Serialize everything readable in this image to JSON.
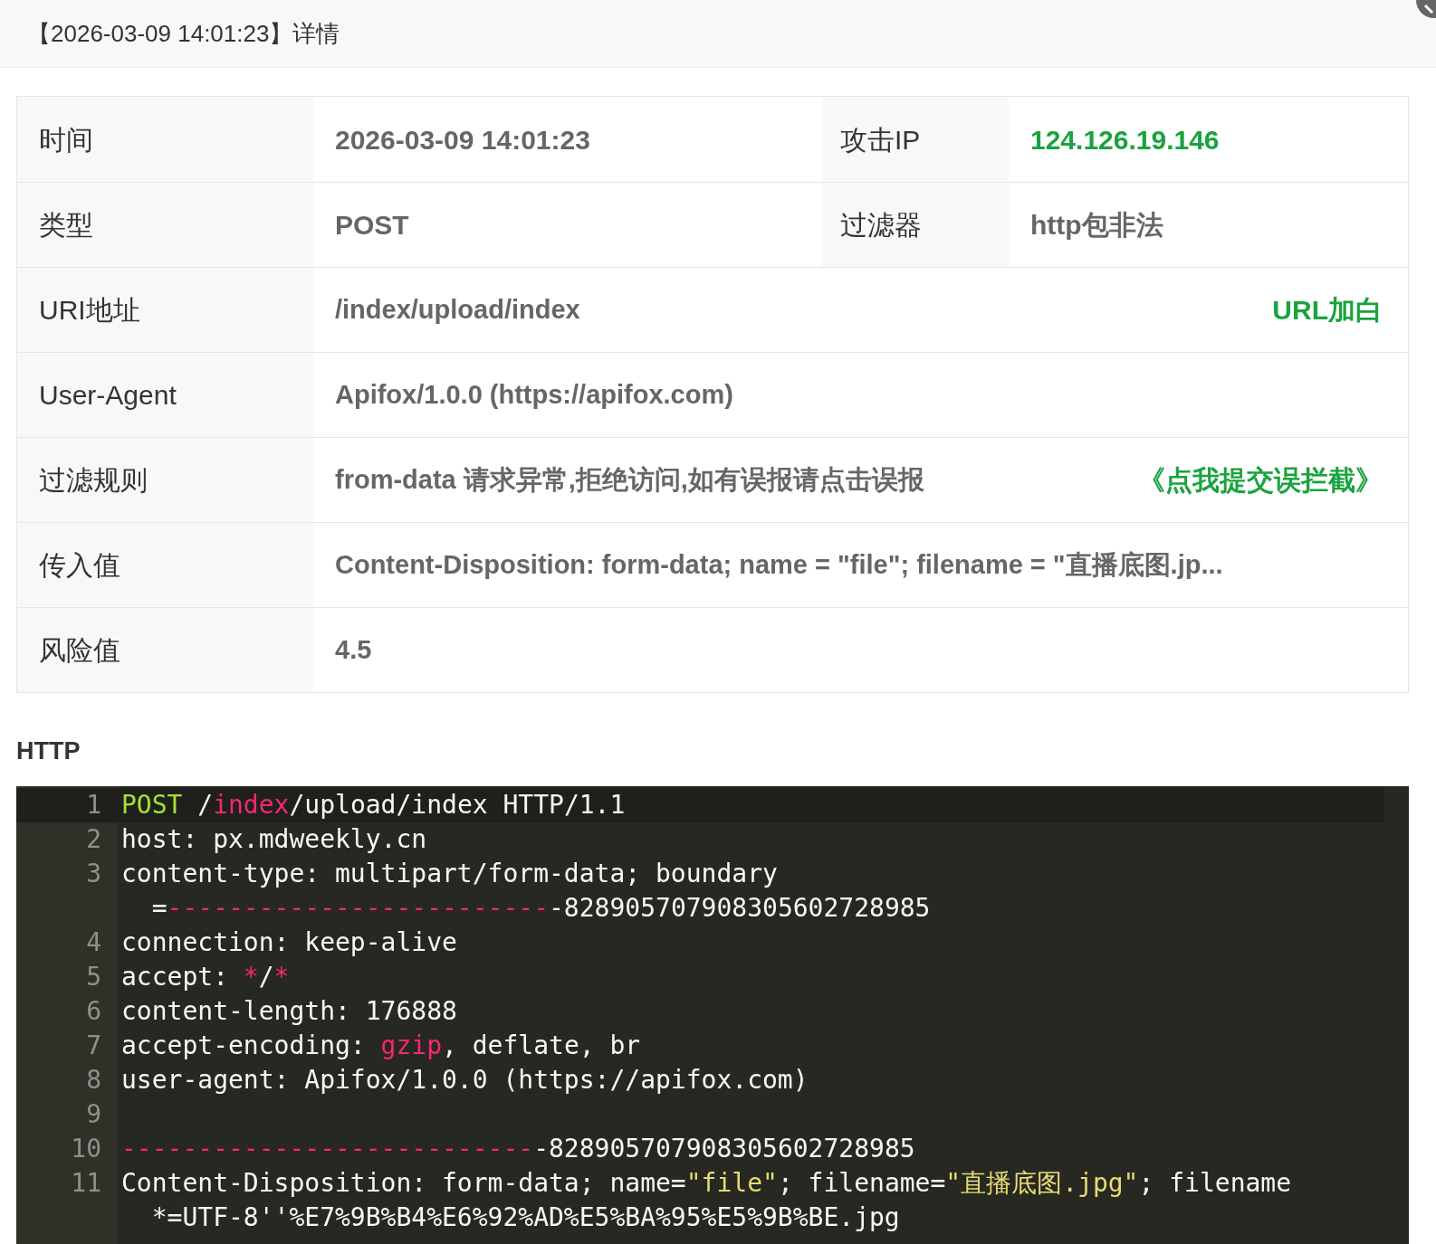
{
  "dialog": {
    "title": "【2026-03-09 14:01:23】详情"
  },
  "details": [
    {
      "kind": "pair",
      "label": "时间",
      "value": "2026-03-09 14:01:23",
      "label_2": "攻击IP",
      "value_2": "124.126.19.146",
      "value_2_highlighted": true
    },
    {
      "kind": "pair",
      "label": "类型",
      "value": "POST",
      "label_2": "过滤器",
      "value_2": "http包非法",
      "value_2_highlighted": false
    },
    {
      "kind": "single",
      "label": "URI地址",
      "value": "/index/upload/index",
      "action": "URL加白"
    },
    {
      "kind": "single",
      "label": "User-Agent",
      "value": "Apifox/1.0.0 (https://apifox.com)"
    },
    {
      "kind": "single",
      "label": "过滤规则",
      "value": "from-data 请求异常,拒绝访问,如有误报请点击误报",
      "action": "《点我提交误拦截》"
    },
    {
      "kind": "single",
      "label": "传入值",
      "value": "Content-Disposition: form-data; name = \"file\"; filename = \"直播底图.jp..."
    },
    {
      "kind": "single",
      "label": "风险值",
      "value": "4.5"
    }
  ],
  "http": {
    "heading": "HTTP",
    "lines": [
      {
        "number": "1",
        "active": true,
        "rows": [
          [
            {
              "text": "POST",
              "kind": "keyword"
            },
            {
              "text": " /",
              "kind": "plain"
            },
            {
              "text": "index",
              "kind": "red"
            },
            {
              "text": "/upload/index HTTP/1.1",
              "kind": "plain"
            }
          ]
        ]
      },
      {
        "number": "2",
        "active": false,
        "rows": [
          [
            {
              "text": "host: px.mdweekly.cn",
              "kind": "plain"
            }
          ]
        ]
      },
      {
        "number": "3",
        "active": false,
        "rows": [
          [
            {
              "text": "content-type: multipart/form-data; boundary",
              "kind": "plain"
            }
          ],
          [
            {
              "text": "  =",
              "kind": "plain"
            },
            {
              "text": "-------------------------",
              "kind": "red"
            },
            {
              "text": "-828905707908305602728985",
              "kind": "plain"
            }
          ]
        ]
      },
      {
        "number": "4",
        "active": false,
        "rows": [
          [
            {
              "text": "connection: keep-alive",
              "kind": "plain"
            }
          ]
        ]
      },
      {
        "number": "5",
        "active": false,
        "rows": [
          [
            {
              "text": "accept: ",
              "kind": "plain"
            },
            {
              "text": "*",
              "kind": "red"
            },
            {
              "text": "/",
              "kind": "plain"
            },
            {
              "text": "*",
              "kind": "red"
            }
          ]
        ]
      },
      {
        "number": "6",
        "active": false,
        "rows": [
          [
            {
              "text": "content-length: 176888",
              "kind": "plain"
            }
          ]
        ]
      },
      {
        "number": "7",
        "active": false,
        "rows": [
          [
            {
              "text": "accept-encoding: ",
              "kind": "plain"
            },
            {
              "text": "gzip",
              "kind": "red"
            },
            {
              "text": ", deflate, br",
              "kind": "plain"
            }
          ]
        ]
      },
      {
        "number": "8",
        "active": false,
        "rows": [
          [
            {
              "text": "user-agent: Apifox/1.0.0 (https://apifox.com)",
              "kind": "plain"
            }
          ]
        ]
      },
      {
        "number": "9",
        "active": false,
        "rows": [
          []
        ]
      },
      {
        "number": "10",
        "active": false,
        "rows": [
          [
            {
              "text": "---------------------------",
              "kind": "red"
            },
            {
              "text": "-828905707908305602728985",
              "kind": "plain"
            }
          ]
        ]
      },
      {
        "number": "11",
        "active": false,
        "rows": [
          [
            {
              "text": "Content-Disposition: form-data; name=",
              "kind": "plain"
            },
            {
              "text": "\"file\"",
              "kind": "string"
            },
            {
              "text": "; filename=",
              "kind": "plain"
            },
            {
              "text": "\"直播底图.jpg\"",
              "kind": "string"
            },
            {
              "text": "; filename",
              "kind": "plain"
            }
          ],
          [
            {
              "text": "  *=UTF-8''%E7%9B%B4%E6%92%AD%E5%BA%95%E5%9B%BE.jpg",
              "kind": "plain"
            }
          ]
        ]
      }
    ]
  }
}
